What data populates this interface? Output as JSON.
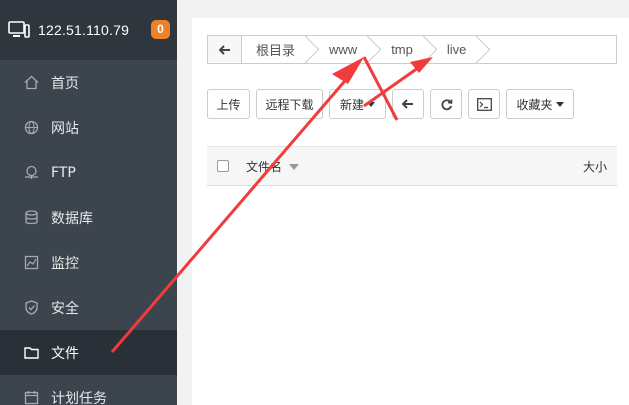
{
  "sidebar": {
    "host": "122.51.110.79",
    "badge": "0",
    "items": [
      {
        "label": "首页",
        "icon": "home-icon",
        "active": false
      },
      {
        "label": "网站",
        "icon": "globe-icon",
        "active": false
      },
      {
        "label": "FTP",
        "icon": "ftp-icon",
        "active": false
      },
      {
        "label": "数据库",
        "icon": "database-icon",
        "active": false
      },
      {
        "label": "监控",
        "icon": "monitor-chart-icon",
        "active": false
      },
      {
        "label": "安全",
        "icon": "shield-icon",
        "active": false
      },
      {
        "label": "文件",
        "icon": "folder-icon",
        "active": true
      },
      {
        "label": "计划任务",
        "icon": "calendar-icon",
        "active": false
      }
    ]
  },
  "path": {
    "crumbs": [
      "根目录",
      "www",
      "tmp",
      "live"
    ]
  },
  "toolbar": {
    "upload": "上传",
    "remote_download": "远程下载",
    "new": "新建",
    "favorites": "收藏夹"
  },
  "table": {
    "col_name": "文件名",
    "col_size": "大小"
  },
  "colors": {
    "sidebar_bg": "#3c444d",
    "badge": "#f0812b",
    "annotation_arrow": "#f03c3c"
  }
}
